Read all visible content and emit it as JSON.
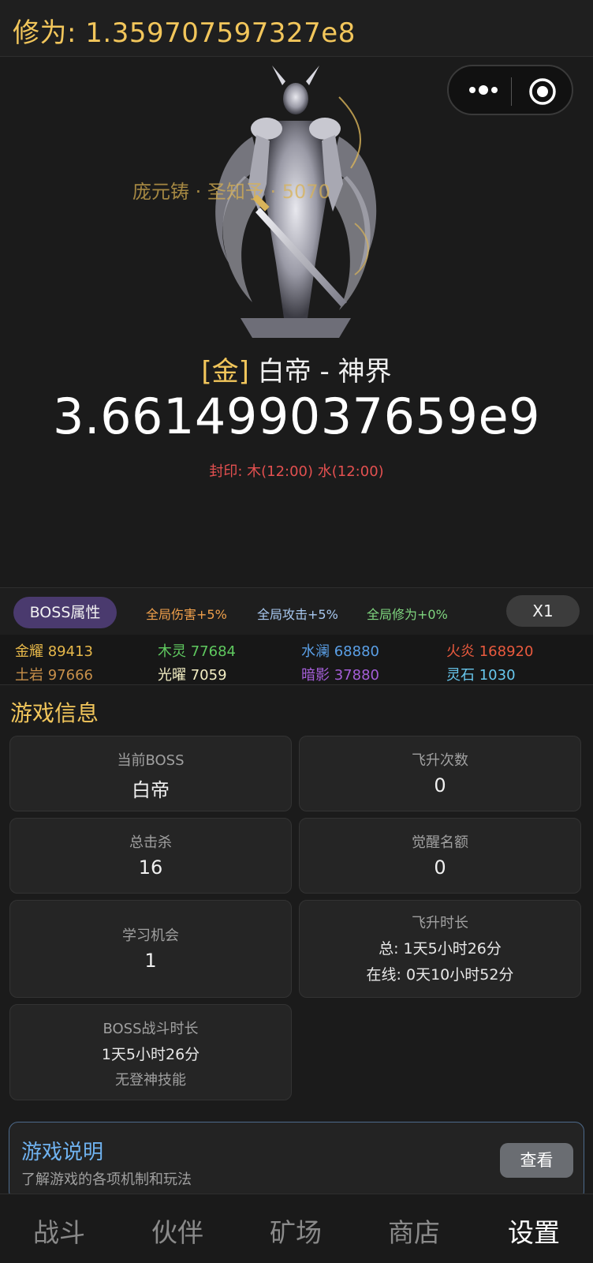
{
  "header": {
    "xiuwei": "修为: 1.359707597327e8"
  },
  "capsule": {
    "more_icon": "more-dots-icon",
    "close_icon": "target-circle-icon"
  },
  "boss": {
    "watermark": "庞元铸 · 圣知予 · 5070",
    "tag": "[金]",
    "name": "白帝 - 神界",
    "hp": "3.661499037659e9",
    "seal": "封印: 木(12:00) 水(12:00)"
  },
  "attr_bar": {
    "boss_button": "BOSS属性",
    "buff_damage": "全局伤害+5%",
    "buff_attack": "全局攻击+5%",
    "buff_xiuwei": "全局修为+0%",
    "speed_button": "X1"
  },
  "elements": [
    {
      "label": "金耀 89413",
      "color": "#e7b84a"
    },
    {
      "label": "木灵 77684",
      "color": "#5fc95f"
    },
    {
      "label": "水澜 68880",
      "color": "#5a9fe6"
    },
    {
      "label": "火炎 168920",
      "color": "#ea5a3e"
    },
    {
      "label": "土岩 97666",
      "color": "#c8904a"
    },
    {
      "label": "光曜 7059",
      "color": "#f4efc4"
    },
    {
      "label": "暗影 37880",
      "color": "#a45ed8"
    },
    {
      "label": "灵石 1030",
      "color": "#68c8ee"
    }
  ],
  "info": {
    "title": "游戏信息",
    "current_boss_label": "当前BOSS",
    "current_boss_value": "白帝",
    "ascend_count_label": "飞升次数",
    "ascend_count_value": "0",
    "total_kills_label": "总击杀",
    "total_kills_value": "16",
    "awaken_quota_label": "觉醒名额",
    "awaken_quota_value": "0",
    "learn_chance_label": "学习机会",
    "learn_chance_value": "1",
    "ascend_time_label": "飞升时长",
    "ascend_time_total": "总: 1天5小时26分",
    "ascend_time_online": "在线: 0天10小时52分",
    "boss_fight_label": "BOSS战斗时长",
    "boss_fight_value": "1天5小时26分",
    "boss_fight_note": "无登神技能"
  },
  "guide": {
    "title": "游戏说明",
    "desc": "了解游戏的各项机制和玩法",
    "button": "查看"
  },
  "nav": [
    "战斗",
    "伙伴",
    "矿场",
    "商店",
    "设置"
  ],
  "nav_active": "设置"
}
